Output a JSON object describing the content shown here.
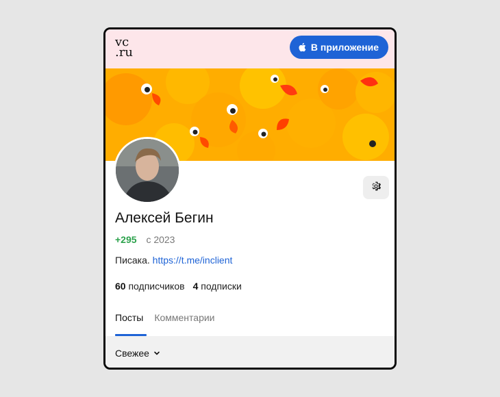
{
  "header": {
    "logo_line1": "vc",
    "logo_line2": ".ru",
    "app_button_label": "В приложение"
  },
  "profile": {
    "name": "Алексей Бегин",
    "karma": "+295",
    "since": "с 2023",
    "bio_text": "Писака. ",
    "bio_link": "https://t.me/inclient",
    "subscribers_count": "60",
    "subscribers_label": "подписчиков",
    "subscriptions_count": "4",
    "subscriptions_label": "подписки"
  },
  "tabs": [
    {
      "label": "Посты",
      "active": true
    },
    {
      "label": "Комментарии",
      "active": false
    }
  ],
  "feed": {
    "sort_label": "Свежее"
  },
  "colors": {
    "accent": "#1e63d6",
    "karma_green": "#2ca24c",
    "header_bg": "#fde6ea",
    "cover_duck": "#ffb400"
  },
  "icons": {
    "app_button": "apple-icon",
    "settings": "gear-icon",
    "sort": "chevron-down-icon"
  }
}
